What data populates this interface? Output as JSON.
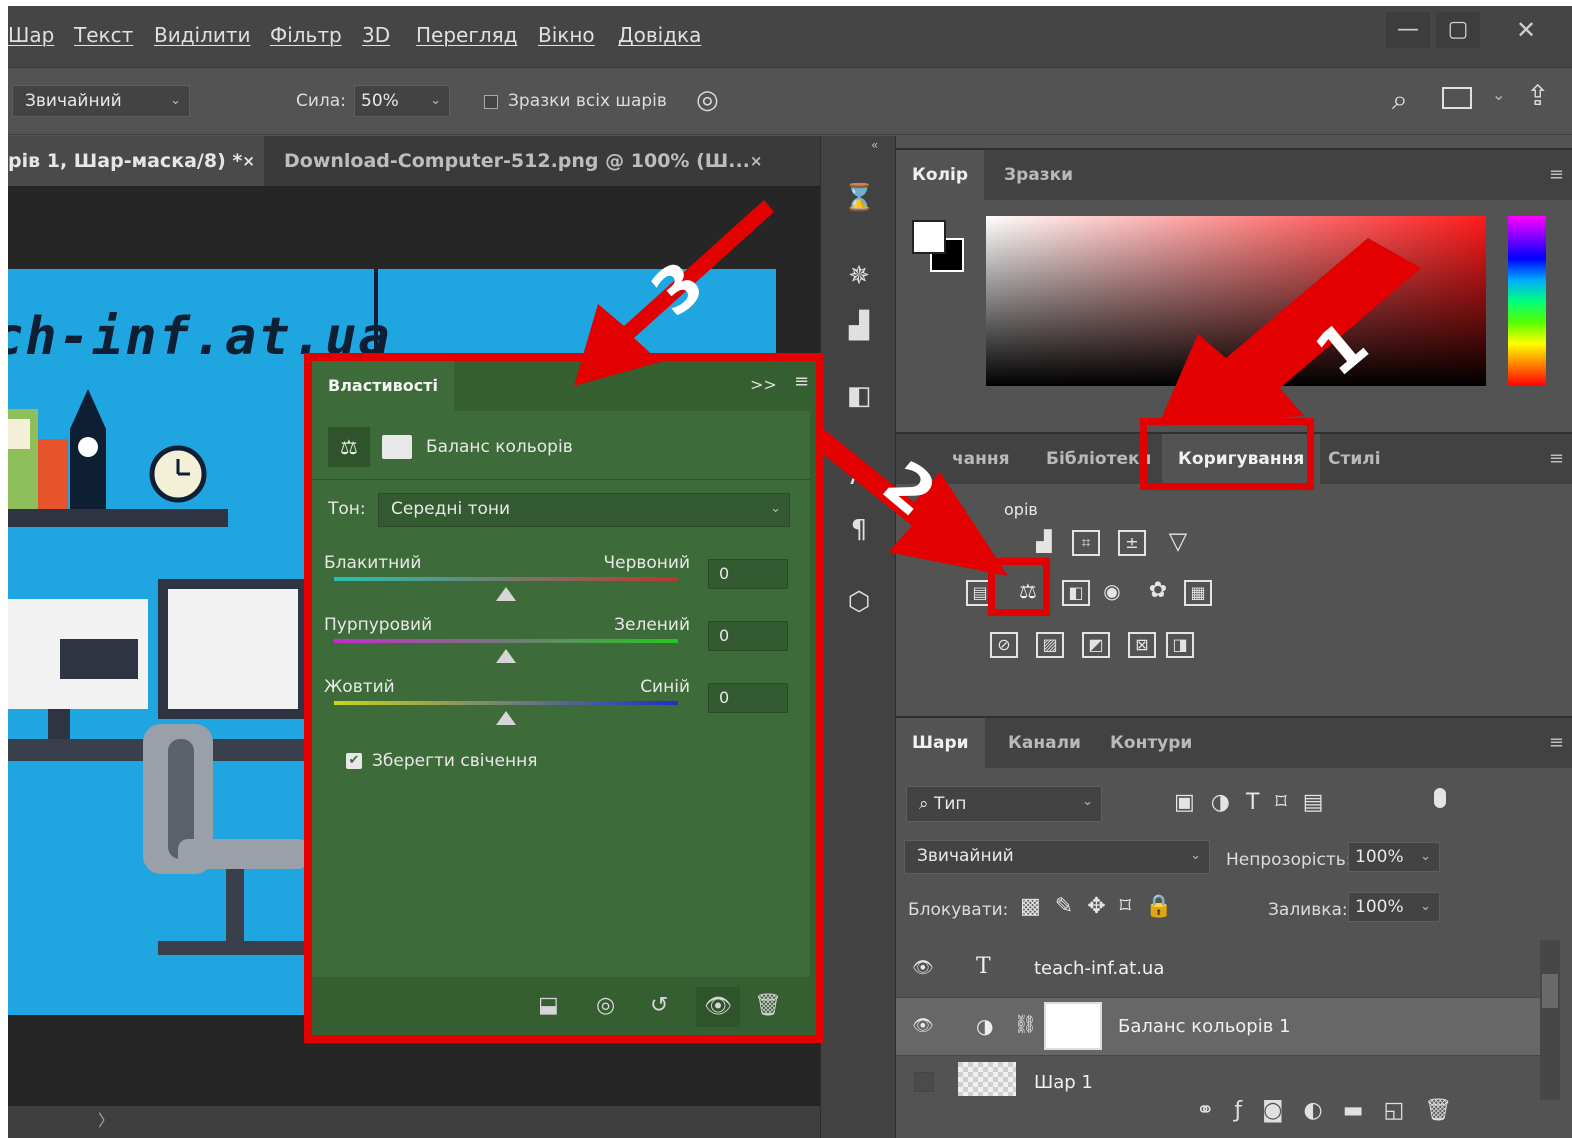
{
  "menu": [
    "Шар",
    "Текст",
    "Виділити",
    "Фільтр",
    "3D",
    "Перегляд",
    "Вікно",
    "Довідка"
  ],
  "window_controls": {
    "minimize": "—",
    "maximize": "▢",
    "close": "✕"
  },
  "options": {
    "mode": "Звичайний",
    "strength_label": "Сила:",
    "strength_value": "50%",
    "sample_all": "Зразки всіх шарів"
  },
  "tabs": [
    {
      "label": "рів 1, Шар-маска/8) *",
      "close": "×"
    },
    {
      "label": "Download-Computer-512.png @ 100% (Ш...",
      "close": "×"
    }
  ],
  "canvas": {
    "site_text": "ch-inf.at.ua"
  },
  "status": {
    "arrow": "〉"
  },
  "color_panel": {
    "tabs": [
      "Колір",
      "Зразки"
    ]
  },
  "adjustments_panel": {
    "tabs": [
      "чання",
      "Бібліотеки",
      "Коригування",
      "Стилі"
    ],
    "partial_title": "орів"
  },
  "properties": {
    "title": "Властивості",
    "collapse": ">>",
    "name": "Баланс кольорів",
    "tone_label": "Тон:",
    "tone_value": "Середні тони",
    "sliders": [
      {
        "left": "Блакитний",
        "right": "Червоний",
        "value": "0",
        "position": 0.5,
        "colors": [
          "#26c2b4",
          "#c0352c"
        ]
      },
      {
        "left": "Пурпуровий",
        "right": "Зелений",
        "value": "0",
        "position": 0.5,
        "colors": [
          "#c52bd1",
          "#1fc91f"
        ]
      },
      {
        "left": "Жовтий",
        "right": "Синій",
        "value": "0",
        "position": 0.5,
        "colors": [
          "#c9d41b",
          "#1f2fc9"
        ]
      }
    ],
    "preserve_label": "Зберегти свічення"
  },
  "layers_panel": {
    "tabs": [
      "Шари",
      "Канали",
      "Контури"
    ],
    "filter_label": "Тип",
    "blend_mode": "Звичайний",
    "opacity_label": "Непрозорість:",
    "opacity_value": "100%",
    "lock_label": "Блокувати:",
    "fill_label": "Заливка:",
    "fill_value": "100%",
    "layers": [
      {
        "name": "teach-inf.at.ua",
        "kind": "text",
        "visible": true
      },
      {
        "name": "Баланс кольорів 1",
        "kind": "adjustment",
        "visible": true
      },
      {
        "name": "Шар 1",
        "kind": "pixel",
        "visible": false
      }
    ]
  },
  "annotations": [
    "1",
    "2",
    "3"
  ],
  "colors": {
    "highlight": "#e30000",
    "props_bg": "#3e6b3a",
    "canvas_blue": "#1fa5e0"
  }
}
